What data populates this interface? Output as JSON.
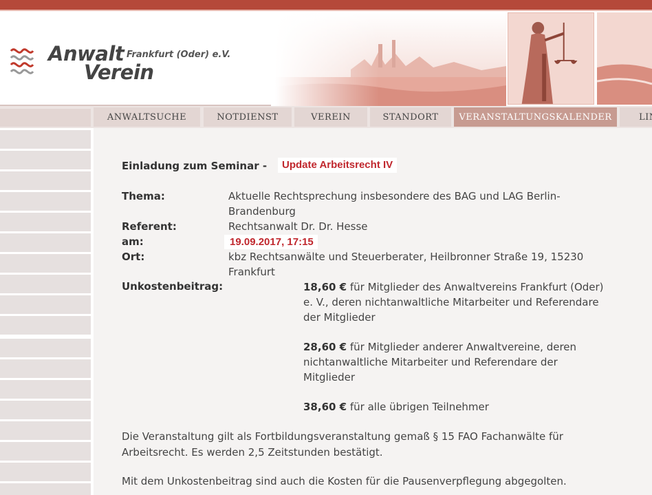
{
  "logo": {
    "name_line1": "Anwalt",
    "location": "Frankfurt (Oder) e.V.",
    "name_line2": "Verein"
  },
  "nav": {
    "items": [
      {
        "label": "ANWALTSUCHE"
      },
      {
        "label": "NOTDIENST"
      },
      {
        "label": "VEREIN"
      },
      {
        "label": "STANDORT"
      },
      {
        "label": "VERANSTALTUNGSKALENDER",
        "active": true
      },
      {
        "label": "LIN"
      }
    ]
  },
  "seminar": {
    "title_prefix": "Einladung zum Seminar - ",
    "title_highlight": "Update Arbeitsrecht IV",
    "thema_label": "Thema:",
    "thema_value": "Aktuelle Rechtsprechung insbesondere des BAG und LAG Berlin-Brandenburg",
    "referent_label": "Referent:",
    "referent_value": "Rechtsanwalt Dr. Dr. Hesse",
    "am_label": "am:",
    "am_value": "19.09.2017,  17:15",
    "ort_label": "Ort:",
    "ort_value": "kbz Rechtsanwälte und Steuerberater, Heilbronner Straße 19, 15230 Frankfurt",
    "beitrag_label": "Unkostenbeitrag:",
    "fees": [
      {
        "amount": "18,60 €",
        "text": " für Mitglieder des Anwaltvereins Frankfurt (Oder) e. V., deren nichtanwaltliche Mitarbeiter und Referendare der Mitglieder"
      },
      {
        "amount": "28,60 €",
        "text": " für Mitglieder anderer Anwaltvereine, deren nichtanwaltliche Mitarbeiter und Referendare der Mitglieder"
      },
      {
        "amount": "38,60 €",
        "text": " für alle übrigen Teilnehmer"
      }
    ],
    "para1": "Die Veranstaltung gilt als Fortbildungsveranstaltung gemaß § 15 FAO Fachanwälte für Arbeitsrecht. Es werden 2,5 Zeitstunden bestätigt.",
    "para2": "Mit dem Unkostenbeitrag sind auch die Kosten für die Pausenverpflegung abgegolten."
  },
  "colors": {
    "brand_red": "#b5493a",
    "highlight_red": "#c0272d",
    "nav_active": "#c79b91"
  }
}
